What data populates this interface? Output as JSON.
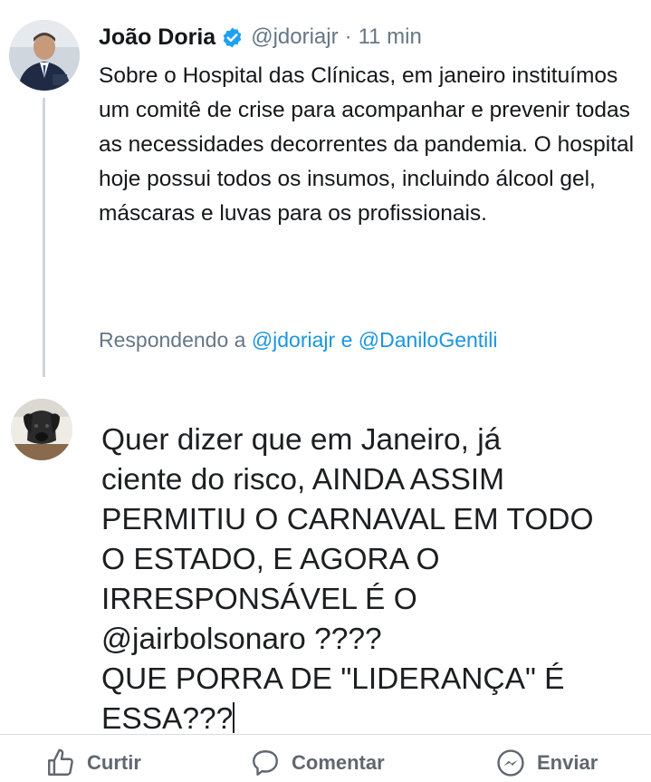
{
  "tweet": {
    "author": "João Doria",
    "handle": "@jdoriajr",
    "separator": "·",
    "time": "11 min",
    "text": "Sobre o Hospital das Clínicas, em janeiro instituímos um comitê de crise para acompanhar e prevenir todas as necessidades decorrentes da pandemia. O hospital hoje possui todos os insumos, incluindo álcool gel, máscaras e luvas para os profissionais.",
    "replying_prefix": "Respondendo a",
    "replying_to": [
      "@jdoriajr",
      "@DaniloGentili"
    ],
    "replying_joiner": "e"
  },
  "comment": {
    "text": "Quer dizer que em Janeiro, já\nciente do risco, AINDA ASSIM\nPERMITIU O CARNAVAL EM TODO\nO ESTADO, E AGORA O\nIRRESPONSÁVEL É O\n@jairbolsonaro ????\nQUE PORRA DE \"LIDERANÇA\" É\nESSA???"
  },
  "actions": {
    "like": "Curtir",
    "comment": "Comentar",
    "send": "Enviar"
  },
  "icons": {
    "verified": "verified-badge-icon",
    "like": "thumbs-up-icon",
    "comment": "speech-bubble-icon",
    "send": "messenger-icon"
  },
  "colors": {
    "verified": "#1da1f2",
    "mention": "#1b95e0",
    "muted": "#657786",
    "action_text": "#606770"
  }
}
